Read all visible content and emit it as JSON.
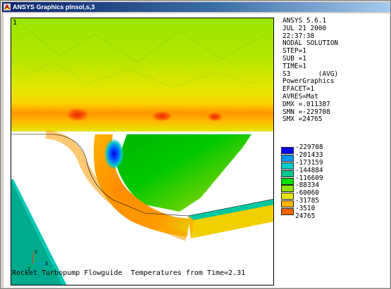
{
  "window": {
    "title": "ANSYS Graphics   plnsol,s,3"
  },
  "plot": {
    "window_number": "1",
    "caption": "Rocket Turbopump Flowguide  Temperatures from Time=2.31",
    "axis_labels": {
      "x": "X",
      "y": "Y",
      "z": "Z"
    }
  },
  "info": {
    "lines": [
      "ANSYS 5.6.1",
      "JUL 21 2000",
      "22:37:38",
      "NODAL SOLUTION",
      "STEP=1",
      "SUB =1",
      "TIME=1",
      "S3       (AVG)",
      "PowerGraphics",
      "EFACET=1",
      "AVRES=Mat",
      "DMX =.011387",
      "SMN =-229708",
      "SMX =24765"
    ]
  },
  "legend": {
    "entries": [
      {
        "label": "-229708",
        "color": "#0000ff"
      },
      {
        "label": "-201433",
        "color": "#0096ff"
      },
      {
        "label": "-173159",
        "color": "#00cccc"
      },
      {
        "label": "-144884",
        "color": "#00c88c"
      },
      {
        "label": "-116609",
        "color": "#00e000"
      },
      {
        "label": "-88334",
        "color": "#8ce600"
      },
      {
        "label": "-60060",
        "color": "#e6e600"
      },
      {
        "label": "-31785",
        "color": "#ffb400"
      },
      {
        "label": "-3510",
        "color": "#ff6400"
      }
    ],
    "end_value": "24765",
    "end_color": "#ff0000"
  }
}
